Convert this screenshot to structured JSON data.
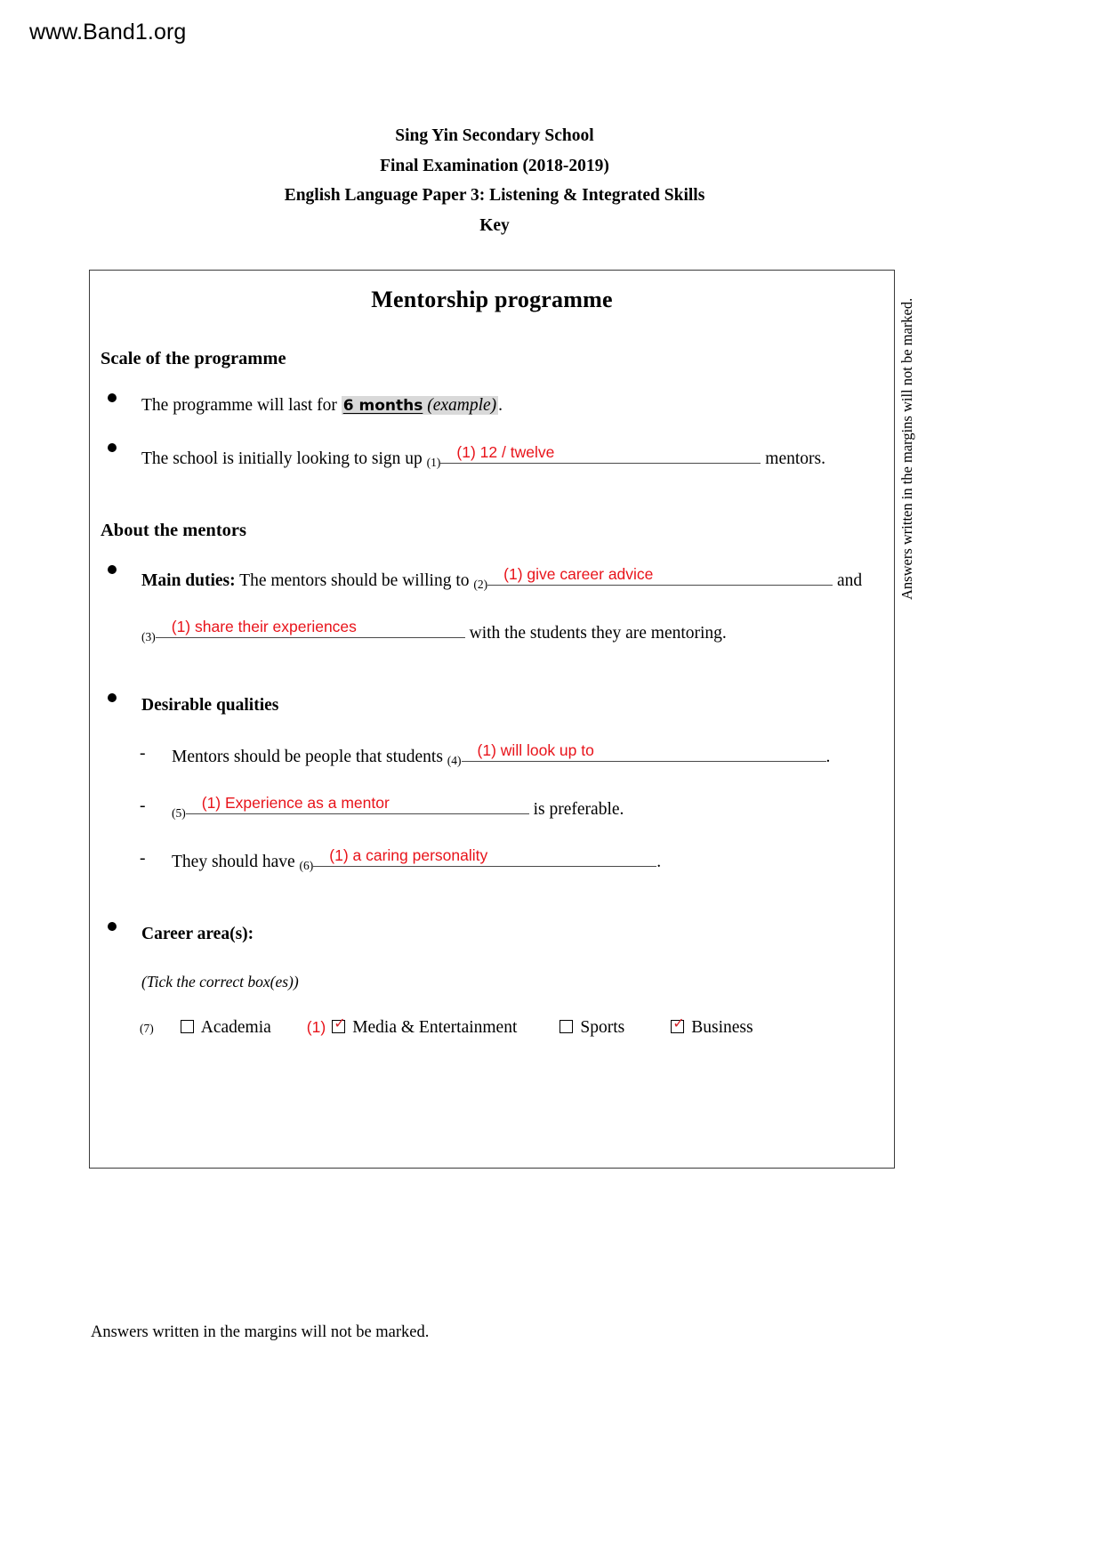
{
  "watermark": "www.Band1.org",
  "header": {
    "line1": "Sing Yin Secondary School",
    "line2": "Final Examination (2018-2019)",
    "line3": "English Language Paper 3: Listening & Integrated Skills",
    "line4": "Key"
  },
  "box": {
    "title": "Mentorship programme",
    "sections": {
      "scale": {
        "heading": "Scale of the programme",
        "bullet1": {
          "text_before": "The programme will last for ",
          "example_answer": "6 months",
          "example_tag": "(example)",
          "text_after": "."
        },
        "bullet2": {
          "text_before": "The school is initially looking to sign up ",
          "qnum": "(1)",
          "answer": "(1) 12 / twelve",
          "text_after": " mentors."
        }
      },
      "mentors": {
        "heading": "About the mentors",
        "duties": {
          "lead": "Main duties:",
          "text_before": " The mentors should be willing to ",
          "qnum2": "(2)",
          "answer2": "(1) give career advice",
          "conjunction": " and",
          "qnum3": "(3)",
          "answer3": "(1) share their experiences",
          "text_after": " with the students they are mentoring."
        },
        "qualities": {
          "heading": "Desirable qualities",
          "items": [
            {
              "dash": "-",
              "text_before": "Mentors should be people that students ",
              "qnum": "(4)",
              "answer": "(1) will look up to",
              "text_after": "."
            },
            {
              "dash": "-",
              "text_before": "",
              "qnum": "(5)",
              "answer": "(1) Experience as a mentor",
              "text_after": " is preferable."
            },
            {
              "dash": "-",
              "text_before": "They should have ",
              "qnum": "(6)",
              "answer": "(1) a caring personality",
              "text_after": "."
            }
          ]
        },
        "career": {
          "heading": "Career area(s):",
          "instruction": "(Tick the correct box(es))",
          "qnum": "(7)",
          "mark": "(1)",
          "options": [
            {
              "label": "Academia",
              "checked": false
            },
            {
              "label": "Media & Entertainment",
              "checked": true
            },
            {
              "label": "Sports",
              "checked": false
            },
            {
              "label": "Business",
              "checked": true
            }
          ]
        }
      }
    }
  },
  "margin_note": "Answers written in the margins will not be marked.",
  "footer_note": "Answers written in the margins will not be marked.",
  "colors": {
    "answer_red": "#e8131a",
    "tick_red": "#d4232a",
    "highlight_gray": "#d9d9d9",
    "box_border": "#3b3b3b"
  }
}
